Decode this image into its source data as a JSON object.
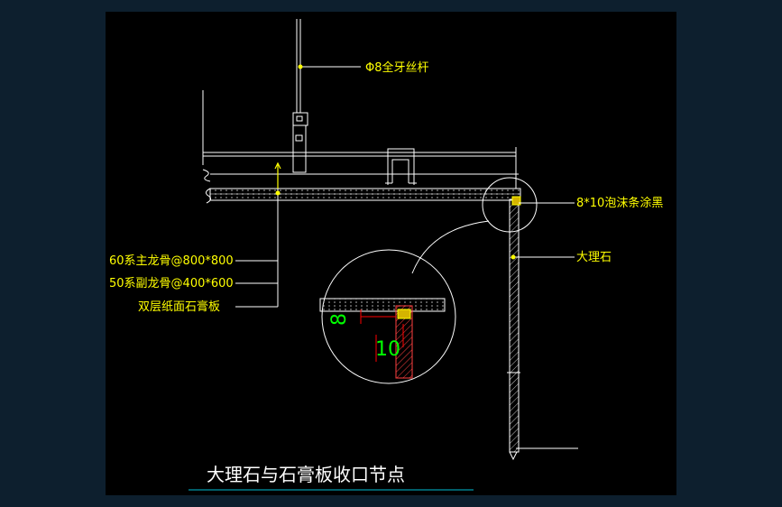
{
  "drawing": {
    "title": "大理石与石膏板收口节点",
    "labels": {
      "threaded_rod": "Φ8全牙丝杆",
      "foam_strip": "8*10泡沫条涂黑",
      "marble": "大理石",
      "main_keel": "60系主龙骨@800*800",
      "sub_keel": "50系副龙骨@400*600",
      "gypsum_board": "双层纸面石膏板"
    },
    "detail_dimensions": {
      "horizontal": "8",
      "vertical": "10"
    },
    "colors": {
      "background": "#000000",
      "frame": "#0d1f2e",
      "label_text": "#ffff00",
      "title_text": "#ffffff",
      "dimension_text": "#00ff00",
      "dimension_line": "#ff0000",
      "linework": "#ffffff"
    }
  }
}
